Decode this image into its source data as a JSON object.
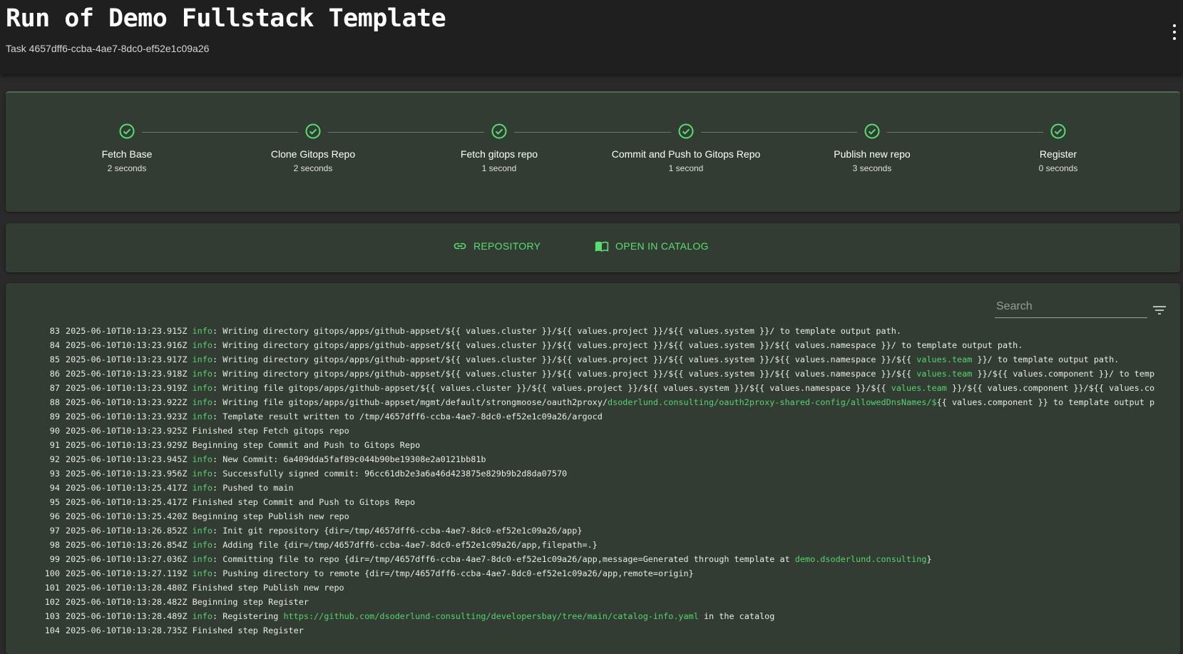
{
  "header": {
    "title": "Run of Demo Fullstack Template",
    "subtitle": "Task 4657dff6-ccba-4ae7-8dc0-ef52e1c09a26",
    "menu_icon": "more-vert-icon"
  },
  "colors": {
    "accent": "#55e070",
    "card_bg": "#323c32",
    "header_bg": "#1f1f1f"
  },
  "steps": [
    {
      "label": "Fetch Base",
      "time": "2 seconds",
      "status": "completed"
    },
    {
      "label": "Clone Gitops Repo",
      "time": "2 seconds",
      "status": "completed"
    },
    {
      "label": "Fetch gitops repo",
      "time": "1 second",
      "status": "completed"
    },
    {
      "label": "Commit and Push to Gitops Repo",
      "time": "1 second",
      "status": "completed"
    },
    {
      "label": "Publish new repo",
      "time": "3 seconds",
      "status": "completed"
    },
    {
      "label": "Register",
      "time": "0 seconds",
      "status": "completed"
    }
  ],
  "links": {
    "repository": {
      "label": "REPOSITORY",
      "icon": "link-icon"
    },
    "catalog": {
      "label": "OPEN IN CATALOG",
      "icon": "catalog-book-icon"
    }
  },
  "logs": {
    "search_placeholder": "Search",
    "filter_icon": "filter-list-icon",
    "lines": [
      {
        "num": "83",
        "ts": "2025-06-10T10:13:23.915Z",
        "level": "info",
        "parts": [
          {
            "t": ": Writing directory gitops/apps/github-appset/${{ values.cluster }}/${{ values.project }}/${{ values.system }}/ to template output path."
          }
        ]
      },
      {
        "num": "84",
        "ts": "2025-06-10T10:13:23.916Z",
        "level": "info",
        "parts": [
          {
            "t": ": Writing directory gitops/apps/github-appset/${{ values.cluster }}/${{ values.project }}/${{ values.system }}/${{ values.namespace }}/ to template output path."
          }
        ]
      },
      {
        "num": "85",
        "ts": "2025-06-10T10:13:23.917Z",
        "level": "info",
        "parts": [
          {
            "t": ": Writing directory gitops/apps/github-appset/${{ values.cluster }}/${{ values.project }}/${{ values.system }}/${{ values.namespace }}/${{ "
          },
          {
            "t": "values.team",
            "hl": true
          },
          {
            "t": " }}/ to template output path."
          }
        ]
      },
      {
        "num": "86",
        "ts": "2025-06-10T10:13:23.918Z",
        "level": "info",
        "parts": [
          {
            "t": ": Writing directory gitops/apps/github-appset/${{ values.cluster }}/${{ values.project }}/${{ values.system }}/${{ values.namespace }}/${{ "
          },
          {
            "t": "values.team",
            "hl": true
          },
          {
            "t": " }}/${{ values.component }}/ to temp"
          }
        ]
      },
      {
        "num": "87",
        "ts": "2025-06-10T10:13:23.919Z",
        "level": "info",
        "parts": [
          {
            "t": ": Writing file gitops/apps/github-appset/${{ values.cluster }}/${{ values.project }}/${{ values.system }}/${{ values.namespace }}/${{ "
          },
          {
            "t": "values.team",
            "hl": true
          },
          {
            "t": " }}/${{ values.component }}/${{ values.co"
          }
        ]
      },
      {
        "num": "88",
        "ts": "2025-06-10T10:13:23.922Z",
        "level": "info",
        "parts": [
          {
            "t": ": Writing file gitops/apps/github-appset/mgmt/default/strongmoose/oauth2proxy/"
          },
          {
            "t": "dsoderlund.consulting/oauth2proxy-shared-config/allowedDnsNames/$",
            "hl": true
          },
          {
            "t": "{{ values.component }} to template output p"
          }
        ]
      },
      {
        "num": "89",
        "ts": "2025-06-10T10:13:23.923Z",
        "level": "info",
        "parts": [
          {
            "t": ": Template result written to /tmp/4657dff6-ccba-4ae7-8dc0-ef52e1c09a26/argocd"
          }
        ]
      },
      {
        "num": "90",
        "ts": "2025-06-10T10:13:23.925Z",
        "level": "",
        "parts": [
          {
            "t": "Finished step Fetch gitops repo"
          }
        ]
      },
      {
        "num": "91",
        "ts": "2025-06-10T10:13:23.929Z",
        "level": "",
        "parts": [
          {
            "t": "Beginning step Commit and Push to Gitops Repo"
          }
        ]
      },
      {
        "num": "92",
        "ts": "2025-06-10T10:13:23.945Z",
        "level": "info",
        "parts": [
          {
            "t": ": New Commit: 6a409dda5faf89c044b90be19308e2a0121bb81b"
          }
        ]
      },
      {
        "num": "93",
        "ts": "2025-06-10T10:13:23.956Z",
        "level": "info",
        "parts": [
          {
            "t": ": Successfully signed commit: 96cc61db2e3a6a46d423875e829b9b2d8da07570"
          }
        ]
      },
      {
        "num": "94",
        "ts": "2025-06-10T10:13:25.417Z",
        "level": "info",
        "parts": [
          {
            "t": ": Pushed to main"
          }
        ]
      },
      {
        "num": "95",
        "ts": "2025-06-10T10:13:25.417Z",
        "level": "",
        "parts": [
          {
            "t": "Finished step Commit and Push to Gitops Repo"
          }
        ]
      },
      {
        "num": "96",
        "ts": "2025-06-10T10:13:25.420Z",
        "level": "",
        "parts": [
          {
            "t": "Beginning step Publish new repo"
          }
        ]
      },
      {
        "num": "97",
        "ts": "2025-06-10T10:13:26.852Z",
        "level": "info",
        "parts": [
          {
            "t": ": Init git repository {dir=/tmp/4657dff6-ccba-4ae7-8dc0-ef52e1c09a26/app}"
          }
        ]
      },
      {
        "num": "98",
        "ts": "2025-06-10T10:13:26.854Z",
        "level": "info",
        "parts": [
          {
            "t": ": Adding file {dir=/tmp/4657dff6-ccba-4ae7-8dc0-ef52e1c09a26/app,filepath=.}"
          }
        ]
      },
      {
        "num": "99",
        "ts": "2025-06-10T10:13:27.036Z",
        "level": "info",
        "parts": [
          {
            "t": ": Committing file to repo {dir=/tmp/4657dff6-ccba-4ae7-8dc0-ef52e1c09a26/app,message=Generated through template at "
          },
          {
            "t": "demo.dsoderlund.consulting",
            "hl": true
          },
          {
            "t": "}"
          }
        ]
      },
      {
        "num": "100",
        "ts": "2025-06-10T10:13:27.119Z",
        "level": "info",
        "parts": [
          {
            "t": ": Pushing directory to remote {dir=/tmp/4657dff6-ccba-4ae7-8dc0-ef52e1c09a26/app,remote=origin}"
          }
        ]
      },
      {
        "num": "101",
        "ts": "2025-06-10T10:13:28.480Z",
        "level": "",
        "parts": [
          {
            "t": "Finished step Publish new repo"
          }
        ]
      },
      {
        "num": "102",
        "ts": "2025-06-10T10:13:28.482Z",
        "level": "",
        "parts": [
          {
            "t": "Beginning step Register"
          }
        ]
      },
      {
        "num": "103",
        "ts": "2025-06-10T10:13:28.489Z",
        "level": "info",
        "parts": [
          {
            "t": ": Registering "
          },
          {
            "t": "https://github.com/dsoderlund-consulting/developersbay/tree/main/catalog-info.yaml",
            "hl": true
          },
          {
            "t": " in the catalog"
          }
        ]
      },
      {
        "num": "104",
        "ts": "2025-06-10T10:13:28.735Z",
        "level": "",
        "parts": [
          {
            "t": "Finished step Register"
          }
        ]
      }
    ]
  }
}
